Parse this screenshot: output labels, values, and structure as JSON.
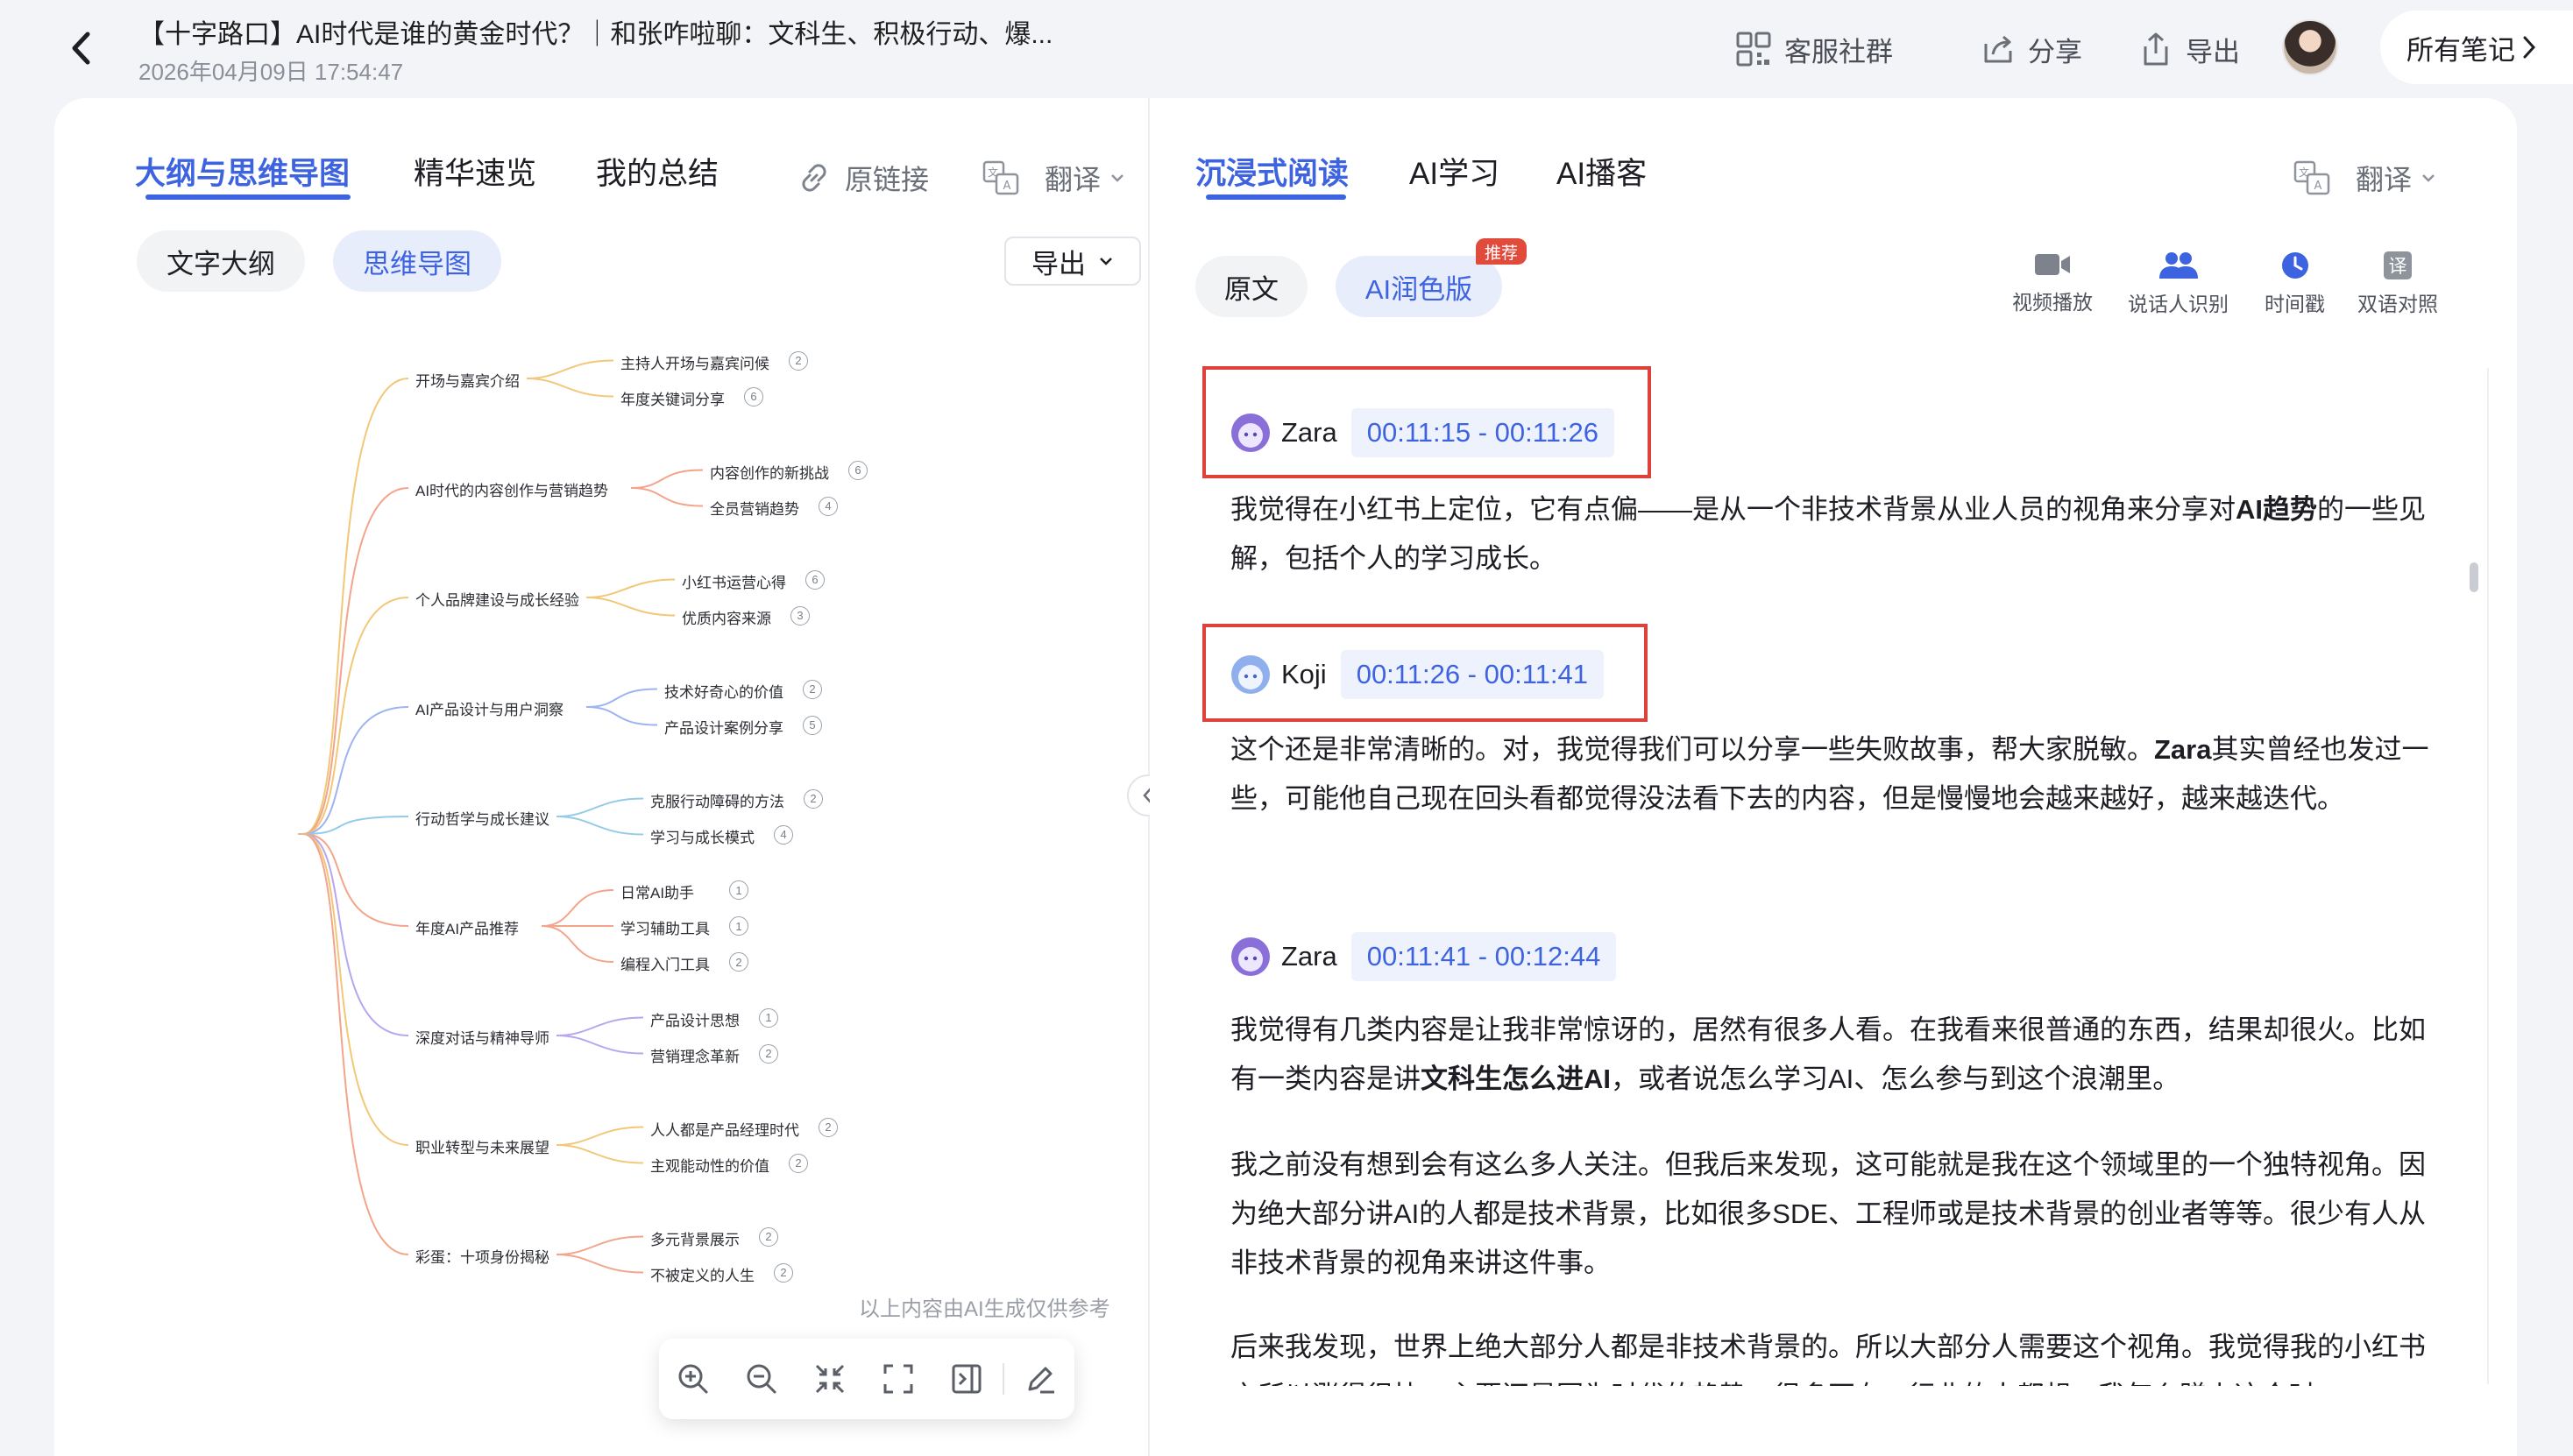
{
  "header": {
    "title": "【十字路口】AI时代是谁的黄金时代？｜和张咋啦聊：文科生、积极行动、爆...",
    "datetime": "2026年04月09日 17:54:47",
    "community_label": "客服社群",
    "share_label": "分享",
    "export_label": "导出",
    "all_notes_label": "所有笔记"
  },
  "left": {
    "tabs": [
      "大纲与思维导图",
      "精华速览",
      "我的总结"
    ],
    "original_link_label": "原链接",
    "translate_label": "翻译",
    "view_text": "文字大纲",
    "view_mindmap": "思维导图",
    "export_label": "导出",
    "disclaimer": "以上内容由AI生成仅供参考"
  },
  "mindmap": {
    "branches": [
      {
        "label": "开场与嘉宾介绍",
        "color": "#f2c777",
        "children": [
          {
            "label": "主持人开场与嘉宾问候",
            "count": "2"
          },
          {
            "label": "年度关键词分享",
            "count": "6"
          }
        ]
      },
      {
        "label": "AI时代的内容创作与营销趋势",
        "color": "#f3a48a",
        "children": [
          {
            "label": "内容创作的新挑战",
            "count": "6"
          },
          {
            "label": "全员营销趋势",
            "count": "4"
          }
        ]
      },
      {
        "label": "个人品牌建设与成长经验",
        "color": "#f2c777",
        "children": [
          {
            "label": "小红书运营心得",
            "count": "6"
          },
          {
            "label": "优质内容来源",
            "count": "3"
          }
        ]
      },
      {
        "label": "AI产品设计与用户洞察",
        "color": "#9db4f0",
        "children": [
          {
            "label": "技术好奇心的价值",
            "count": "2"
          },
          {
            "label": "产品设计案例分享",
            "count": "5"
          }
        ]
      },
      {
        "label": "行动哲学与成长建议",
        "color": "#93cbe8",
        "children": [
          {
            "label": "克服行动障碍的方法",
            "count": "2"
          },
          {
            "label": "学习与成长模式",
            "count": "4"
          }
        ]
      },
      {
        "label": "年度AI产品推荐",
        "color": "#f3a48a",
        "children": [
          {
            "label": "日常AI助手",
            "count": "1"
          },
          {
            "label": "学习辅助工具",
            "count": "1"
          },
          {
            "label": "编程入门工具",
            "count": "2"
          }
        ]
      },
      {
        "label": "深度对话与精神导师",
        "color": "#b7a6ee",
        "children": [
          {
            "label": "产品设计思想",
            "count": "1"
          },
          {
            "label": "营销理念革新",
            "count": "2"
          }
        ]
      },
      {
        "label": "职业转型与未来展望",
        "color": "#f2c777",
        "children": [
          {
            "label": "人人都是产品经理时代",
            "count": "2"
          },
          {
            "label": "主观能动性的价值",
            "count": "2"
          }
        ]
      },
      {
        "label": "彩蛋：十项身份揭秘",
        "color": "#f3a48a",
        "children": [
          {
            "label": "多元背景展示",
            "count": "2"
          },
          {
            "label": "不被定义的人生",
            "count": "2"
          }
        ]
      }
    ]
  },
  "right": {
    "tabs": [
      "沉浸式阅读",
      "AI学习",
      "AI播客"
    ],
    "translate_label": "翻译",
    "view_original": "原文",
    "view_polished": "AI润色版",
    "recommend_badge": "推荐",
    "tools": [
      {
        "label": "视频播放",
        "icon": "video-icon",
        "color": "#7d828c"
      },
      {
        "label": "说话人识别",
        "icon": "speakers-icon",
        "color": "#3d63e0"
      },
      {
        "label": "时间戳",
        "icon": "clock-icon",
        "color": "#3d63e0"
      },
      {
        "label": "双语对照",
        "icon": "bilingual-icon",
        "color": "#7d828c"
      }
    ]
  },
  "transcript": [
    {
      "speaker": "Zara",
      "time": "00:11:15 - 00:11:26"
    },
    {
      "speaker": "Koji",
      "time": "00:11:26 - 00:11:41"
    },
    {
      "speaker": "Zara",
      "time": "00:11:41 - 00:12:44"
    }
  ],
  "paragraphs": {
    "p1a": "我觉得在小红书上定位，它有点偏——是从一个非技术背景从业人员的视角来分享对",
    "p1b": "AI趋势",
    "p1c": "的一些见解，包括个人的学习成长。",
    "p2a": "这个还是非常清晰的。对，我觉得我们可以分享一些失败故事，帮大家脱敏。",
    "p2b": "Zara",
    "p2c": "其实曾经也发过一些，可能他自己现在回头看都觉得没法看下去的内容，但是慢慢地会越来越好，越来越迭代。",
    "p3a": "我觉得有几类内容是让我非常惊讶的，居然有很多人看。在我看来很普通的东西，结果却很火。比如有一类内容是讲",
    "p3b": "文科生怎么进AI",
    "p3c": "，或者说怎么学习AI、怎么参与到这个浪潮里。",
    "p4": "我之前没有想到会有这么多人关注。但我后来发现，这可能就是我在这个领域里的一个独特视角。因为绝大部分讲AI的人都是技术背景，比如很多SDE、工程师或是技术背景的创业者等等。很少有人从非技术背景的视角来讲这件事。",
    "p5": "后来我发现，世界上绝大部分人都是非技术背景的。所以大部分人需要这个视角。我觉得我的小红书之所以涨得很快，主要还是因为时代的趋势。很多不在AI行业的人都想：我怎么蹭上这个时"
  }
}
